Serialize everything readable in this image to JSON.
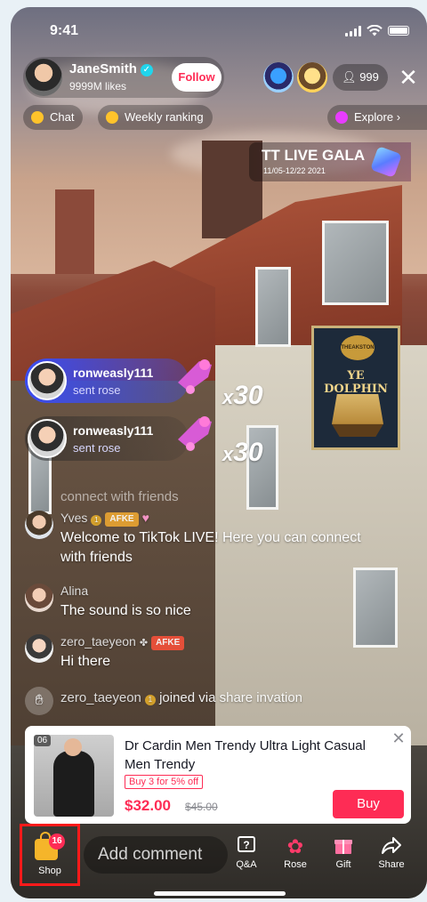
{
  "status_bar": {
    "time": "9:41"
  },
  "host": {
    "name": "JaneSmith",
    "likes": "9999M likes",
    "follow_label": "Follow"
  },
  "viewer_count": "999",
  "chips": {
    "chat": "Chat",
    "weekly_ranking": "Weekly ranking",
    "explore": "Explore"
  },
  "gala": {
    "title": "TT LIVE GALA",
    "dates": "11/05-12/22 2021"
  },
  "gifts": [
    {
      "user": "ronweasly111",
      "action": "sent rose",
      "multiplier": "30"
    },
    {
      "user": "ronweasly111",
      "action": "sent rose",
      "multiplier": "30"
    }
  ],
  "faded_message": "connect with friends",
  "chat": [
    {
      "user": "Yves",
      "badge": "AFKE",
      "message": "Welcome to TikTok LIVE! Here you can connect with friends"
    },
    {
      "user": "Alina",
      "message": "The sound is so nice"
    },
    {
      "user": "zero_taeyeon",
      "badge": "AFKE",
      "message": "Hi there"
    },
    {
      "user": "zero_taeyeon",
      "message": "joined via share invation"
    }
  ],
  "product": {
    "number": "06",
    "title": "Dr Cardin Men Trendy Ultra Light Casual Men Trendy",
    "promo": "Buy 3 for 5% off",
    "price": "$32.00",
    "old_price": "$45.00",
    "buy_label": "Buy"
  },
  "bottom_bar": {
    "shop_label": "Shop",
    "shop_count": "16",
    "comment_placeholder": "Add comment",
    "actions": [
      "Q&A",
      "Rose",
      "Gift",
      "Share"
    ]
  },
  "colors": {
    "accent": "#fe2c55",
    "verified": "#20d5ec",
    "badge": "#ffc32b"
  }
}
